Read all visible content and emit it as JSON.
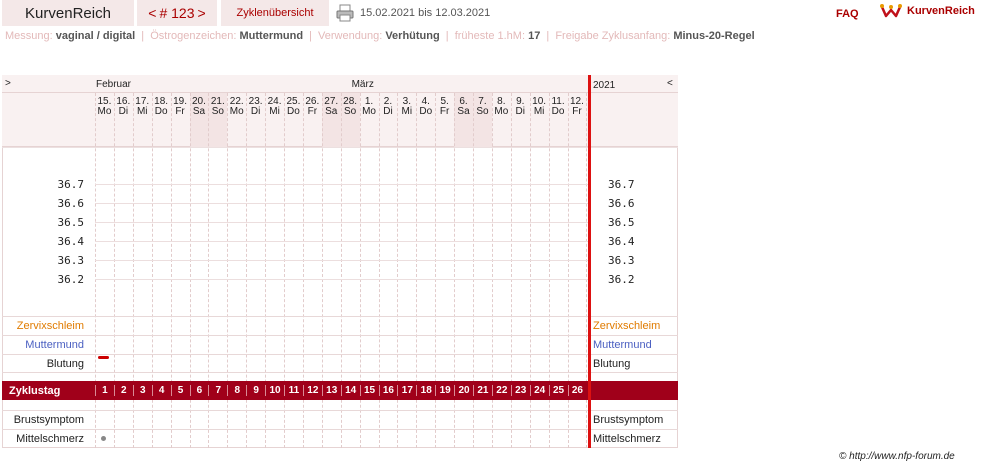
{
  "header": {
    "brand": "KurvenReich",
    "nav_prev": "<",
    "nav_label": "# 123",
    "nav_next": ">",
    "tab_overview": "Zyklenübersicht",
    "daterange": "15.02.2021 bis 12.03.2021",
    "faq": "FAQ",
    "logo_text": "KurvenReich"
  },
  "info": {
    "messung_label": "Messung:",
    "messung_value": "vaginal / digital",
    "oestrogen_label": "Östrogenzeichen:",
    "oestrogen_value": "Muttermund",
    "verwendung_label": "Verwendung:",
    "verwendung_value": "Verhütung",
    "hm_label": "früheste 1.hM:",
    "hm_value": "17",
    "freigabe_label": "Freigabe Zyklusanfang:",
    "freigabe_value": "Minus-20-Regel",
    "sep": "|"
  },
  "chart": {
    "left_toggle": ">",
    "right_toggle": "<",
    "month_feb": "Februar",
    "month_mar": "März",
    "year": "2021",
    "days": [
      {
        "d": "15.",
        "w": "Mo",
        "weekend": false
      },
      {
        "d": "16.",
        "w": "Di",
        "weekend": false
      },
      {
        "d": "17.",
        "w": "Mi",
        "weekend": false
      },
      {
        "d": "18.",
        "w": "Do",
        "weekend": false
      },
      {
        "d": "19.",
        "w": "Fr",
        "weekend": false
      },
      {
        "d": "20.",
        "w": "Sa",
        "weekend": true
      },
      {
        "d": "21.",
        "w": "So",
        "weekend": true
      },
      {
        "d": "22.",
        "w": "Mo",
        "weekend": false
      },
      {
        "d": "23.",
        "w": "Di",
        "weekend": false
      },
      {
        "d": "24.",
        "w": "Mi",
        "weekend": false
      },
      {
        "d": "25.",
        "w": "Do",
        "weekend": false
      },
      {
        "d": "26.",
        "w": "Fr",
        "weekend": false
      },
      {
        "d": "27.",
        "w": "Sa",
        "weekend": true
      },
      {
        "d": "28.",
        "w": "So",
        "weekend": true
      },
      {
        "d": "1.",
        "w": "Mo",
        "weekend": false
      },
      {
        "d": "2.",
        "w": "Di",
        "weekend": false
      },
      {
        "d": "3.",
        "w": "Mi",
        "weekend": false
      },
      {
        "d": "4.",
        "w": "Do",
        "weekend": false
      },
      {
        "d": "5.",
        "w": "Fr",
        "weekend": false
      },
      {
        "d": "6.",
        "w": "Sa",
        "weekend": true
      },
      {
        "d": "7.",
        "w": "So",
        "weekend": true
      },
      {
        "d": "8.",
        "w": "Mo",
        "weekend": false
      },
      {
        "d": "9.",
        "w": "Di",
        "weekend": false
      },
      {
        "d": "10.",
        "w": "Mi",
        "weekend": false
      },
      {
        "d": "11.",
        "w": "Do",
        "weekend": false
      },
      {
        "d": "12.",
        "w": "Fr",
        "weekend": false
      }
    ],
    "temps": [
      "36.7",
      "36.6",
      "36.5",
      "36.4",
      "36.3",
      "36.2"
    ],
    "rows": {
      "zervix": "Zervixschleim",
      "muttermund": "Muttermund",
      "blutung": "Blutung",
      "zyklustag": "Zyklustag",
      "brust": "Brustsymptom",
      "mittelschmerz": "Mittelschmerz"
    },
    "cycle_days": [
      "1",
      "2",
      "3",
      "4",
      "5",
      "6",
      "7",
      "8",
      "9",
      "10",
      "11",
      "12",
      "13",
      "14",
      "15",
      "16",
      "17",
      "18",
      "19",
      "20",
      "21",
      "22",
      "23",
      "24",
      "25",
      "26"
    ],
    "bleeding_day": 1,
    "mittelschmerz_day": 1,
    "colors": {
      "accent": "#a0001a",
      "zervix": "#e07b00",
      "muttermund": "#4a5fc1",
      "weekend": "#f3e4e4",
      "header_bg": "#f9f1f1"
    }
  },
  "footer": {
    "copyright": "© http://www.nfp-forum.de"
  }
}
